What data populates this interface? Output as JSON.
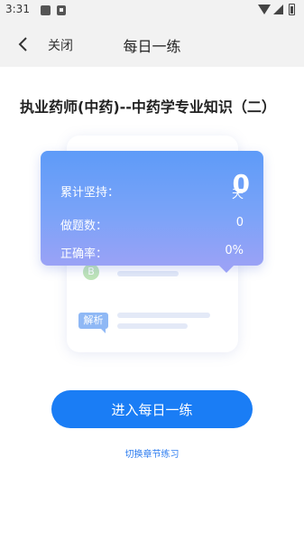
{
  "status_bar": {
    "time": "3:31"
  },
  "nav": {
    "close_label": "关闭",
    "title": "每日一练"
  },
  "page_title": "执业药师(中药)--中药学专业知识（二）",
  "stats": {
    "streak_label": "累计坚持：",
    "streak_value": "0",
    "streak_unit": "天",
    "questions_label": "做题数：",
    "questions_value": "0",
    "accuracy_label": "正确率：",
    "accuracy_value": "0%"
  },
  "card_illustration": {
    "option_letter": "B",
    "analysis_badge": "解析"
  },
  "actions": {
    "enter_label": "进入每日一练",
    "switch_label": "切换章节练习"
  },
  "colors": {
    "primary": "#1a7df5",
    "popup_top": "#5e9bf8",
    "popup_bottom": "#9aa2f6",
    "link": "#2f7ef0"
  }
}
